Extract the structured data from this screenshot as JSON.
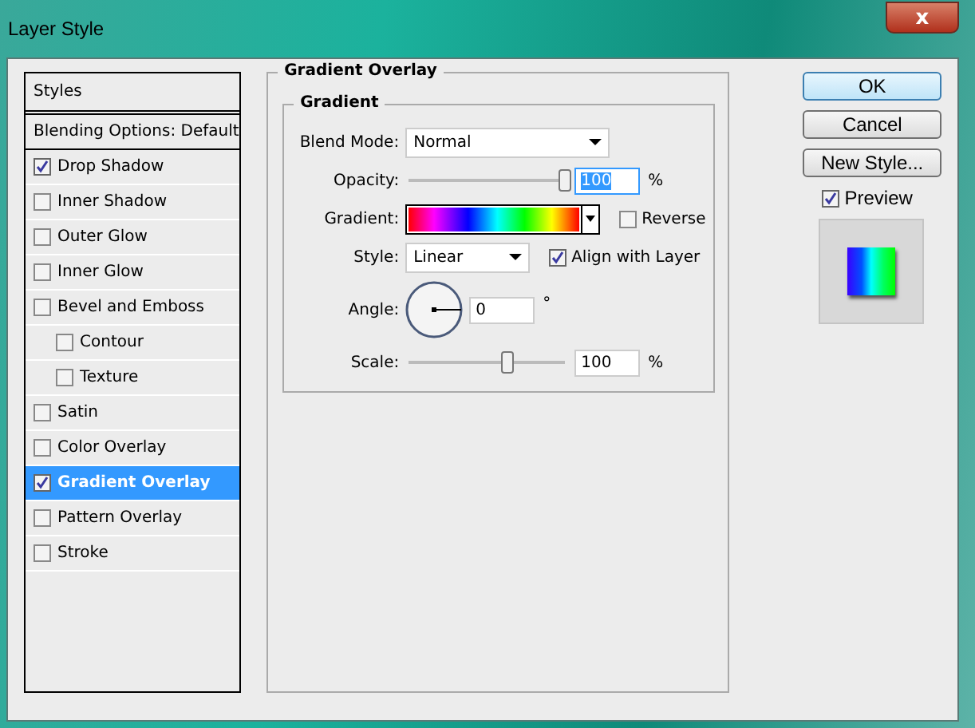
{
  "window": {
    "title": "Layer Style",
    "close": "x"
  },
  "sidebar": {
    "header": "Styles",
    "blending": "Blending Options: Default",
    "items": [
      {
        "label": "Drop Shadow",
        "checked": true,
        "selected": false
      },
      {
        "label": "Inner Shadow",
        "checked": false,
        "selected": false
      },
      {
        "label": "Outer Glow",
        "checked": false,
        "selected": false
      },
      {
        "label": "Inner Glow",
        "checked": false,
        "selected": false
      },
      {
        "label": "Bevel and Emboss",
        "checked": false,
        "selected": false,
        "children": [
          {
            "label": "Contour",
            "checked": false,
            "selected": false
          },
          {
            "label": "Texture",
            "checked": false,
            "selected": false
          }
        ]
      },
      {
        "label": "Satin",
        "checked": false,
        "selected": false
      },
      {
        "label": "Color Overlay",
        "checked": false,
        "selected": false
      },
      {
        "label": "Gradient Overlay",
        "checked": true,
        "selected": true
      },
      {
        "label": "Pattern Overlay",
        "checked": false,
        "selected": false
      },
      {
        "label": "Stroke",
        "checked": false,
        "selected": false
      }
    ]
  },
  "panel": {
    "title": "Gradient Overlay",
    "group": "Gradient",
    "blend_mode": {
      "label": "Blend Mode:",
      "value": "Normal"
    },
    "opacity": {
      "label": "Opacity:",
      "level": 1.0,
      "value": "100",
      "unit": "%"
    },
    "gradient": {
      "label": "Gradient:",
      "reverse": {
        "label": "Reverse",
        "checked": false
      }
    },
    "style": {
      "label": "Style:",
      "value": "Linear",
      "align": {
        "label": "Align with Layer",
        "checked": true
      }
    },
    "angle": {
      "label": "Angle:",
      "value": "0",
      "unit": "°"
    },
    "scale": {
      "label": "Scale:",
      "level": 0.63,
      "value": "100",
      "unit": "%"
    }
  },
  "buttons": [
    {
      "label": "OK",
      "kind": "default"
    },
    {
      "label": "Cancel",
      "kind": "normal"
    },
    {
      "label": "New Style...",
      "kind": "normal"
    }
  ],
  "preview": {
    "label": "Preview",
    "checked": true
  }
}
